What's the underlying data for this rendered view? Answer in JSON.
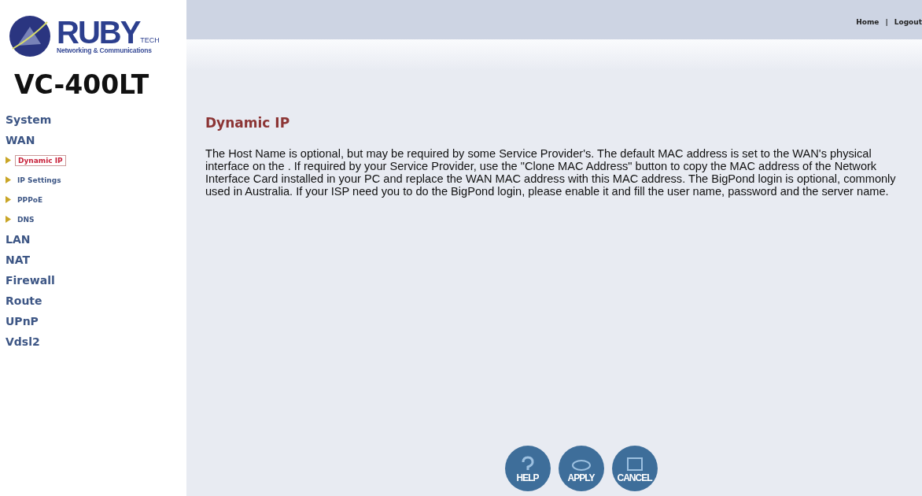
{
  "logo": {
    "brand": "RUBY",
    "brand_suffix": "TECH",
    "tagline": "Networking & Communications"
  },
  "model": "VC-400LT",
  "nav": [
    {
      "label": "System",
      "kind": "section",
      "selected": false
    },
    {
      "label": "WAN",
      "kind": "section",
      "selected": false
    },
    {
      "label": "Dynamic IP",
      "kind": "sub",
      "selected": true
    },
    {
      "label": "IP Settings",
      "kind": "sub",
      "selected": false
    },
    {
      "label": "PPPoE",
      "kind": "sub",
      "selected": false
    },
    {
      "label": "DNS",
      "kind": "sub",
      "selected": false
    },
    {
      "label": "LAN",
      "kind": "section",
      "selected": false
    },
    {
      "label": "NAT",
      "kind": "section",
      "selected": false
    },
    {
      "label": "Firewall",
      "kind": "section",
      "selected": false
    },
    {
      "label": "Route",
      "kind": "section",
      "selected": false
    },
    {
      "label": "UPnP",
      "kind": "section",
      "selected": false
    },
    {
      "label": "Vdsl2",
      "kind": "section",
      "selected": false
    }
  ],
  "top_links": [
    {
      "label": "Home"
    },
    {
      "label": "Logout"
    }
  ],
  "top_separator": "|",
  "page": {
    "title": "Dynamic IP",
    "description": "The Host Name is optional, but may be required by some Service Provider's. The default MAC address is set to the WAN's physical interface on the . If required by your Service Provider, use the \"Clone MAC Address\" button to copy the MAC address of the Network Interface Card installed in your PC and replace the WAN MAC address with this MAC address. The BigPond login is optional, commonly used in Australia. If your ISP need you to do the BigPond login, please enable it and fill the user name, password and the server name."
  },
  "buttons": [
    {
      "label": "HELP",
      "kind": "help"
    },
    {
      "label": "APPLY",
      "kind": "apply"
    },
    {
      "label": "CANCEL",
      "kind": "cancel"
    }
  ]
}
